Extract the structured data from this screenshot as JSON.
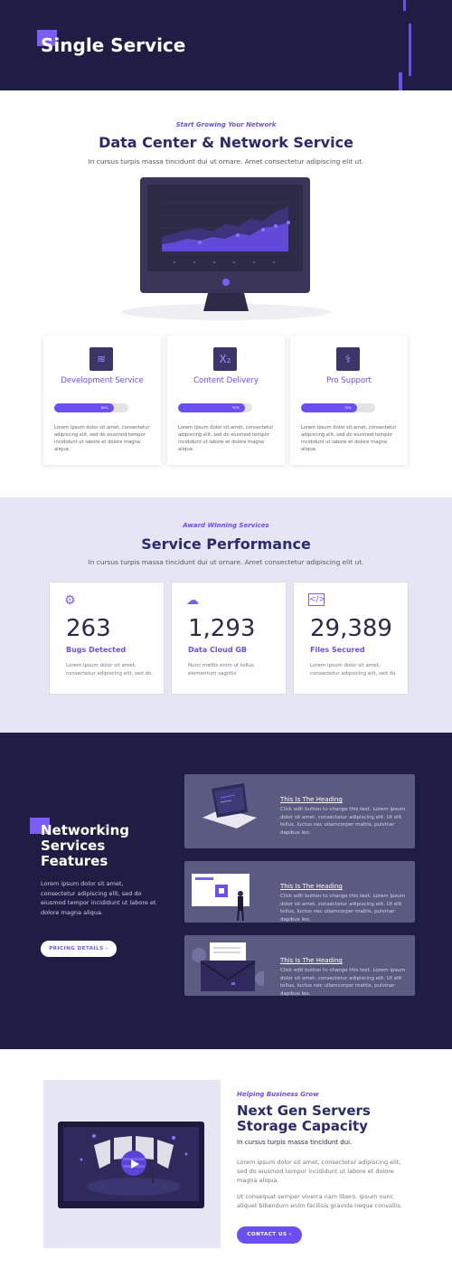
{
  "hero": {
    "title": "Single Service"
  },
  "network": {
    "kicker": "Start Growing Your Network",
    "title": "Data Center & Network Service",
    "subtitle": "In cursus turpis massa tincidunt dui ut ornare. Amet consectetur adipiscing elit ut."
  },
  "service_cards": [
    {
      "icon": "stack-icon",
      "title": "Development Service",
      "progress": 0.8,
      "progress_label": "80%",
      "desc": "Lorem ipsum dolor sit amet, consectetur adipiscing elit, sed do eiusmod tempor incididunt ut labore et dolore magna aliqua."
    },
    {
      "icon": "subscript-icon",
      "title": "Content Delivery",
      "progress": 0.9,
      "progress_label": "90%",
      "desc": "Lorem ipsum dolor sit amet, consectetur adipiscing elit, sed do eiusmod tempor incididunt ut labore et dolore magna aliqua."
    },
    {
      "icon": "stethoscope-icon",
      "title": "Pro Support",
      "progress": 0.75,
      "progress_label": "75%",
      "desc": "Lorem ipsum dolor sit amet, consectetur adipiscing elit, sed do eiusmod tempor incididunt ut labore et dolore magna aliqua."
    }
  ],
  "performance": {
    "kicker": "Award Winning Services",
    "title": "Service Performance",
    "subtitle": "In cursus turpis massa tincidunt dui ut ornare. Amet consectetur adipiscing elit ut."
  },
  "stats": [
    {
      "icon": "bug-tools-icon",
      "number": "263",
      "label": "Bugs Detected",
      "desc": "Lorem ipsum dolor sit amet, consectetur adipiscing elit, sed do."
    },
    {
      "icon": "cloud-network-icon",
      "number": "1,293",
      "label": "Data Cloud GB",
      "desc": "Nunc mattis enim ut tellus elementum sagittis"
    },
    {
      "icon": "code-window-icon",
      "number": "29,389",
      "label": "Files Secured",
      "desc": "Lorem ipsum dolor sit amet, consectetur adipiscing elit, sed do."
    }
  ],
  "features": {
    "title": "Networking Services Features",
    "body": "Lorem ipsum dolor sit amet, consectetur adipiscing elit, sed do eiusmod tempor incididunt ut labore et dolore magna aliqua.",
    "button": "PRICING DETAILS",
    "items": [
      {
        "heading": "This Is The Heading",
        "text": "Click edit button to change this text. Lorem ipsum dolor sit amet, consectetur adipiscing elit. Ut elit tellus, luctus nec ullamcorper mattis, pulvinar dapibus leo."
      },
      {
        "heading": "This Is The Heading",
        "text": "Click edit button to change this text. Lorem ipsum dolor sit amet, consectetur adipiscing elit. Ut elit tellus, luctus nec ullamcorper mattis, pulvinar dapibus leo."
      },
      {
        "heading": "This Is The Heading",
        "text": "Click edit button to change this text. Lorem ipsum dolor sit amet, consectetur adipiscing elit. Ut elit tellus, luctus nec ullamcorper mattis, pulvinar dapibus leo."
      }
    ]
  },
  "servers": {
    "kicker": "Helping Business Grow",
    "title": "Next Gen Servers Storage Capacity",
    "subtitle": "In cursus turpis massa tincidunt dui.",
    "para1": "Lorem ipsum dolor sit amet, consectetur adipiscing elit, sed do eiusmod tempor incididunt ut labore et dolore magna aliqua.",
    "para2": "Ut consequat semper viverra nam libero. Ipsum nunc aliquet bibendum enim facilisis gravida neque convallis.",
    "button": "CONTACT US"
  },
  "colors": {
    "accent": "#6b4ff0",
    "dark": "#201d44",
    "lavender": "#e6e5f4"
  }
}
